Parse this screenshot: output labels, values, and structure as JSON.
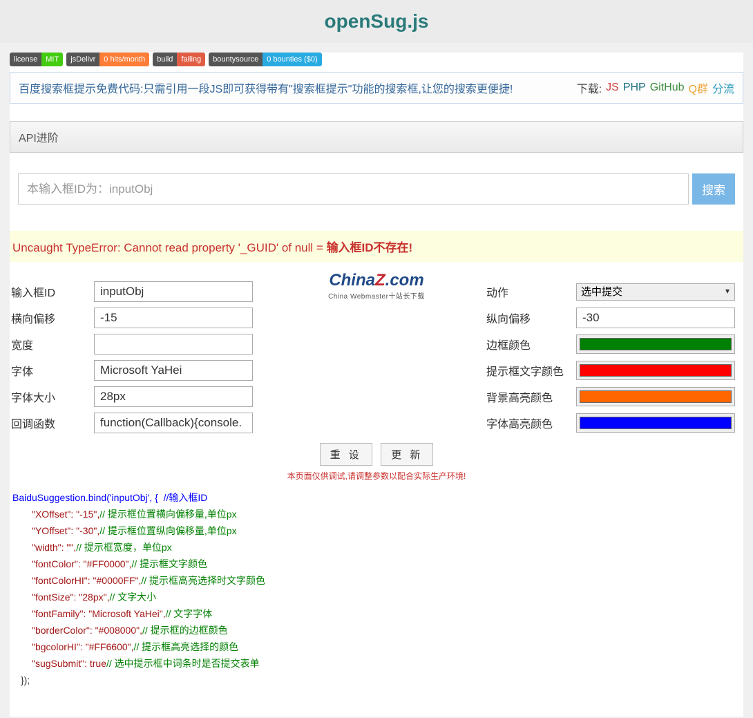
{
  "header": {
    "title": "openSug.js"
  },
  "badges": [
    {
      "left": "license",
      "right": "MIT",
      "rcls": "badge-green"
    },
    {
      "left": "jsDelivr",
      "right": "0 hits/month",
      "rcls": "badge-orange"
    },
    {
      "left": "build",
      "right": "failing",
      "rcls": "badge-red"
    },
    {
      "left": "bountysource",
      "right": "0 bounties ($0)",
      "rcls": "badge-blue"
    }
  ],
  "tagline": "百度搜索框提示免费代码:只需引用一段JS即可获得带有\"搜索框提示\"功能的搜索框,让您的搜索更便捷!",
  "download": {
    "label": "下载: ",
    "js": "JS",
    "php": "PHP",
    "github": "GitHub",
    "qq": "Q群",
    "shunt": "分流"
  },
  "api_header": "API进阶",
  "search": {
    "placeholder": "本输入框ID为：inputObj",
    "value": "",
    "button": "搜索"
  },
  "error": {
    "text": "Uncaught TypeError: Cannot read property '_GUID' of null = ",
    "bold": "输入框ID不存在!"
  },
  "form": {
    "input_id": {
      "label": "输入框ID",
      "value": "inputObj"
    },
    "action": {
      "label": "动作",
      "value": "选中提交"
    },
    "x_offset": {
      "label": "横向偏移",
      "value": "-15"
    },
    "y_offset": {
      "label": "纵向偏移",
      "value": "-30"
    },
    "width": {
      "label": "宽度",
      "value": ""
    },
    "border_color": {
      "label": "边框颜色",
      "value": "#008000"
    },
    "font": {
      "label": "字体",
      "value": "Microsoft YaHei"
    },
    "font_color": {
      "label": "提示框文字颜色",
      "value": "#FF0000"
    },
    "font_size": {
      "label": "字体大小",
      "value": "28px"
    },
    "bg_hi_color": {
      "label": "背景高亮颜色",
      "value": "#FF6600"
    },
    "callback": {
      "label": "回调函数",
      "value": "function(Callback){console."
    },
    "font_hi_color": {
      "label": "字体高亮颜色",
      "value": "#0000FF"
    }
  },
  "buttons": {
    "reset": "重 设",
    "update": "更 新"
  },
  "debug_note": "本页面仅供调试,请调整参数以配合实际生产环境!",
  "code": {
    "line_top": "BaiduSuggestion.bind('inputObj', {  //输入框ID",
    "lines": [
      {
        "key": "\"XOffset\": \"-15\",",
        "comment": "// 提示框位置横向偏移量,单位px"
      },
      {
        "key": "\"YOffset\": \"-30\",",
        "comment": "// 提示框位置纵向偏移量,单位px"
      },
      {
        "key": "\"width\": \"\",",
        "comment": "// 提示框宽度，单位px"
      },
      {
        "key": "\"fontColor\": \"#FF0000\",",
        "comment": "// 提示框文字颜色"
      },
      {
        "key": "\"fontColorHI\": \"#0000FF\",",
        "comment": "// 提示框高亮选择时文字颜色"
      },
      {
        "key": "\"fontSize\": \"28px\",",
        "comment": "// 文字大小"
      },
      {
        "key": "\"fontFamily\": \"Microsoft YaHei\",",
        "comment": "// 文字字体"
      },
      {
        "key": "\"borderColor\": \"#008000\",",
        "comment": "// 提示框的边框颜色"
      },
      {
        "key": "\"bgcolorHI\": \"#FF6600\",",
        "comment": "// 提示框高亮选择的颜色"
      },
      {
        "key": "\"sugSubmit\": true",
        "comment": "// 选中提示框中词条时是否提交表单"
      }
    ],
    "close": "});"
  },
  "watermark": {
    "brand_prefix": "China",
    "brand_z": "Z",
    "brand_suffix": ".com",
    "sub": "China Webmaster十站长下载"
  }
}
